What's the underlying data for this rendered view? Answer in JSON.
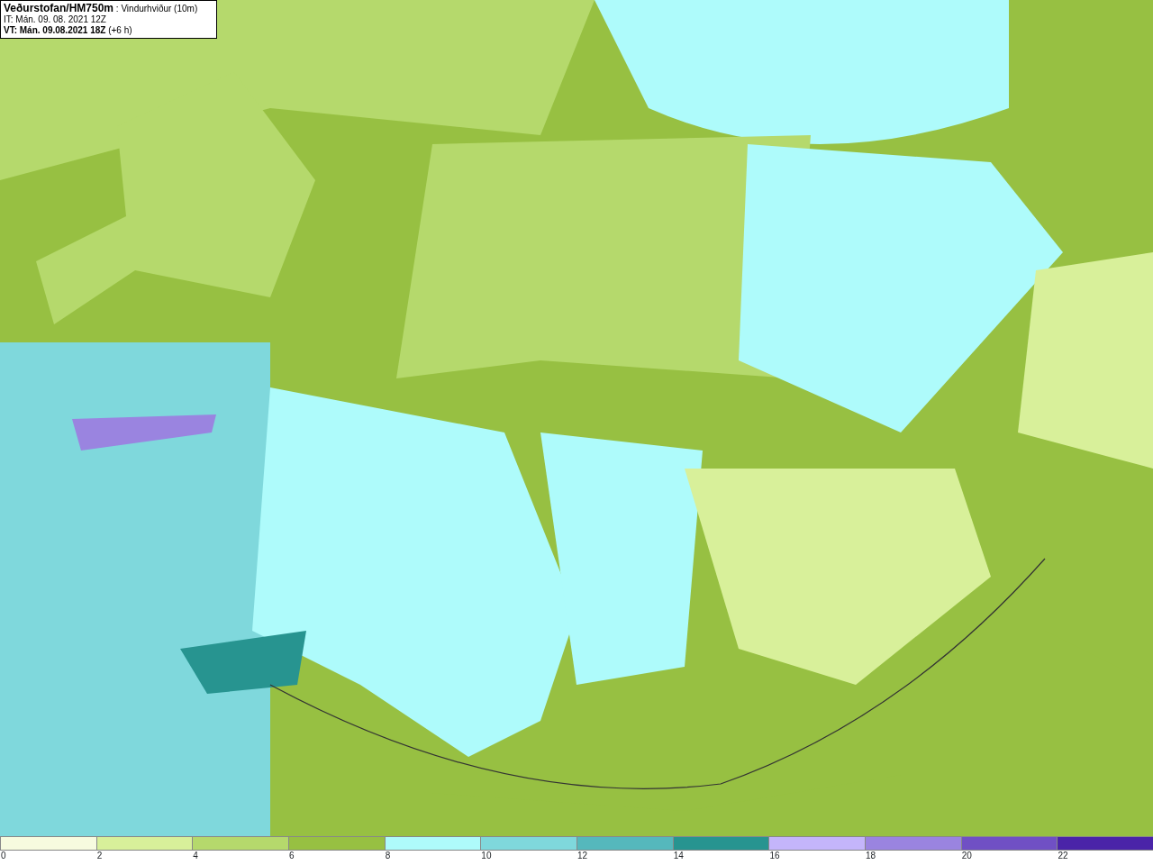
{
  "header": {
    "source": "Veðurstofan/HM750m",
    "field": ": Vindurhviður (10m)",
    "initial_time": "IT: Mán. 09. 08. 2021 12Z",
    "valid_time": "VT: Mán. 09.08.2021 18Z",
    "lead": "(+6 h)"
  },
  "legend": [
    {
      "color": "#f7fbdf",
      "label": "0"
    },
    {
      "color": "#d8f09a",
      "label": "2"
    },
    {
      "color": "#b5d96c",
      "label": "4"
    },
    {
      "color": "#97c042",
      "label": "6"
    },
    {
      "color": "#aefbfb",
      "label": "8"
    },
    {
      "color": "#7fd8dc",
      "label": "10"
    },
    {
      "color": "#55b8bc",
      "label": "12"
    },
    {
      "color": "#279490",
      "label": "14"
    },
    {
      "color": "#c4b5fb",
      "label": "16"
    },
    {
      "color": "#9a84e0",
      "label": "18"
    },
    {
      "color": "#7050c4",
      "label": "20"
    },
    {
      "color": "#4a24a8",
      "label": "22"
    }
  ]
}
